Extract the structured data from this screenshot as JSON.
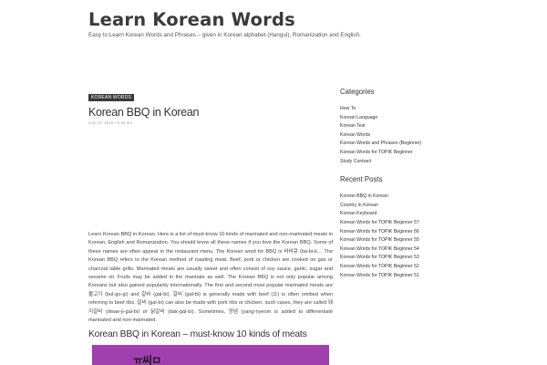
{
  "site": {
    "title": "Learn Korean Words",
    "description": "Easy to Learn Korean Words and Phrases – given in Korean alphabet (Hangul), Romanization and English."
  },
  "post": {
    "category": "KOREAN WORDS",
    "title": "Korean BBQ in Korean",
    "date": "July 10, 2015 • 6:42 am",
    "body": "Learn Korean BBQ in Korean. Here is a list of must-know 10 kinds of marinated and non-marinated meats in Korean, English and Romanization. You should know all these names if you love the Korean BBQ. Some of these names are often appear in the restaurant menu. The Korean word for BBQ is 바비큐 (ba-bi-k… The Korean BBQ refers to the Korean method of roasting meat. Beef, pork or chicken are cooked on gas or charcoal table grills. Marinated meats are usually sweet and often consist of soy sauce, garlic, sugar and sesame oil. Fruits may be added in the marinate as well. The Korean BBQ is not only popular among Koreans but also gained popularity internationally. The first and second most popular marinated meats are 불고기 (bul-go-gi) and 갈비 (gal-bi). 갈비 (gal-bi) is generally made with beef (소) is often omitted when referring to beef ribs. 갈비 (gal-bi) can also be made with pork ribs or chicken. such cases, they are called 돼지갈비 (dwae-ji-gal-bi) or 닭갈비 (dak-gal-bi). Sometimes, 양념 (yang-nyeom is added to differentiate marinated and non-marinated.",
    "subheading": "Korean BBQ in Korean – must-know 10 kinds of meats",
    "image_text": "ㅠ씨ㅁ"
  },
  "sidebar": {
    "categories_title": "Categories",
    "categories": [
      "How To",
      "Korean Language",
      "Korean Test",
      "Korean Words",
      "Korean Words and Phrases (Beginner)",
      "Korean Words for TOPIK Beginner",
      "Study Contract"
    ],
    "recent_title": "Recent Posts",
    "recent": [
      "Korean BBQ in Korean",
      "Country in Korean",
      "Korean Keyboard",
      "Korean Words for TOPIK Beginner 57",
      "Korean Words for TOPIK Beginner 56",
      "Korean Words for TOPIK Beginner 55",
      "Korean Words for TOPIK Beginner 54",
      "Korean Words for TOPIK Beginner 53",
      "Korean Words for TOPIK Beginner 52",
      "Korean Words for TOPIK Beginner 51"
    ]
  },
  "colors": {
    "badge_bg": "#3a3a3a",
    "image_bg": "#a23fae"
  }
}
